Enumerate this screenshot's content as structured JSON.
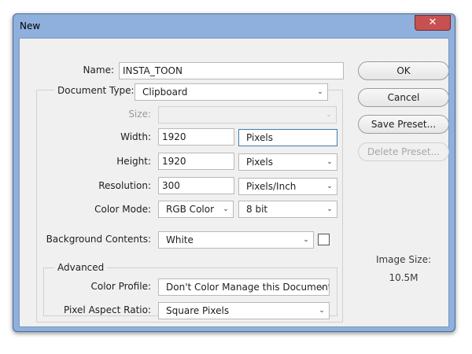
{
  "window": {
    "title": "New",
    "close_glyph": "✕"
  },
  "form": {
    "name": {
      "label": "Name:",
      "value": "INSTA_TOON"
    },
    "document_type": {
      "label": "Document Type:",
      "value": "Clipboard"
    },
    "size": {
      "label": "Size:",
      "value": ""
    },
    "width": {
      "label": "Width:",
      "value": "1920",
      "unit": "Pixels"
    },
    "height": {
      "label": "Height:",
      "value": "1920",
      "unit": "Pixels"
    },
    "resolution": {
      "label": "Resolution:",
      "value": "300",
      "unit": "Pixels/Inch"
    },
    "color_mode": {
      "label": "Color Mode:",
      "value": "RGB Color",
      "depth": "8 bit"
    },
    "background_contents": {
      "label": "Background Contents:",
      "value": "White"
    },
    "advanced": {
      "legend": "Advanced",
      "color_profile": {
        "label": "Color Profile:",
        "value": "Don't Color Manage this Document"
      },
      "pixel_aspect_ratio": {
        "label": "Pixel Aspect Ratio:",
        "value": "Square Pixels"
      }
    }
  },
  "buttons": {
    "ok": "OK",
    "cancel": "Cancel",
    "save_preset": "Save Preset...",
    "delete_preset": "Delete Preset..."
  },
  "image_size": {
    "label": "Image Size:",
    "value": "10.5M"
  },
  "icons": {
    "dropdown": "chevron-down-icon",
    "close": "close-icon"
  }
}
